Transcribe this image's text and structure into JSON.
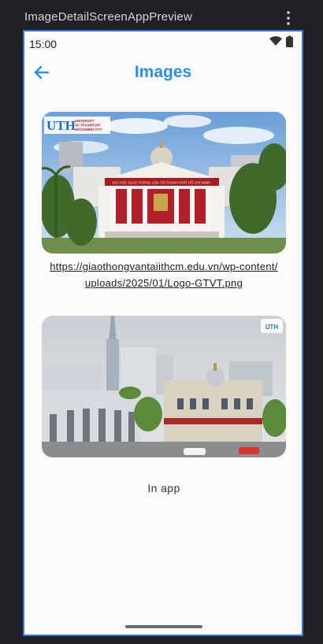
{
  "preview": {
    "title": "ImageDetailScreenAppPreview",
    "menu_icon": "more-vert-icon"
  },
  "status_bar": {
    "time": "15:00",
    "icons": [
      "wifi-icon",
      "battery-icon"
    ]
  },
  "app_bar": {
    "title": "Images",
    "back_icon": "arrow-back-icon",
    "accent_color": "#2d8fe0"
  },
  "images": [
    {
      "caption_line1": "https://giaothongvantaiithcm.edu.vn/wp-content/",
      "caption_line2": "uploads/2025/01/Logo-GTVT.png",
      "logo_main": "UTH",
      "logo_line1": "UNIVERSITY",
      "logo_line2": "OF TRANSPORT",
      "logo_line3": "HOCHIMINH CITY",
      "banner": "ĐẠI HỌC GIAO THÔNG VẬN TẢI THÀNH PHỐ HỒ CHÍ MINH"
    },
    {
      "caption": "In app",
      "badge": "UTH"
    }
  ]
}
